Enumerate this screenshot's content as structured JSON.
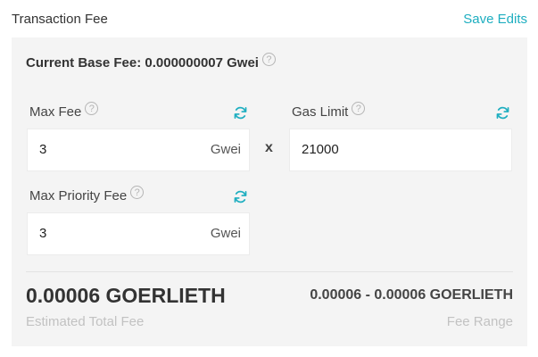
{
  "header": {
    "title": "Transaction Fee",
    "save_label": "Save Edits"
  },
  "base_fee": {
    "text": "Current Base Fee: 0.000000007 Gwei",
    "help_glyph": "?"
  },
  "max_fee": {
    "label": "Max Fee",
    "help_glyph": "?",
    "value": "3",
    "unit": "Gwei"
  },
  "gas_limit": {
    "label": "Gas Limit",
    "help_glyph": "?",
    "value": "21000"
  },
  "operator": "x",
  "max_priority_fee": {
    "label": "Max Priority Fee",
    "help_glyph": "?",
    "value": "3",
    "unit": "Gwei"
  },
  "summary": {
    "total_amount": "0.00006 GOERLIETH",
    "total_caption": "Estimated Total Fee",
    "range_amount": "0.00006 - 0.00006 GOERLIETH",
    "range_caption": "Fee Range"
  },
  "colors": {
    "accent": "#1eaec0",
    "panel_bg": "#f4f4f4",
    "muted_text": "#c2c2c2"
  },
  "icons": {
    "refresh": "refresh-icon",
    "help": "help-icon"
  }
}
